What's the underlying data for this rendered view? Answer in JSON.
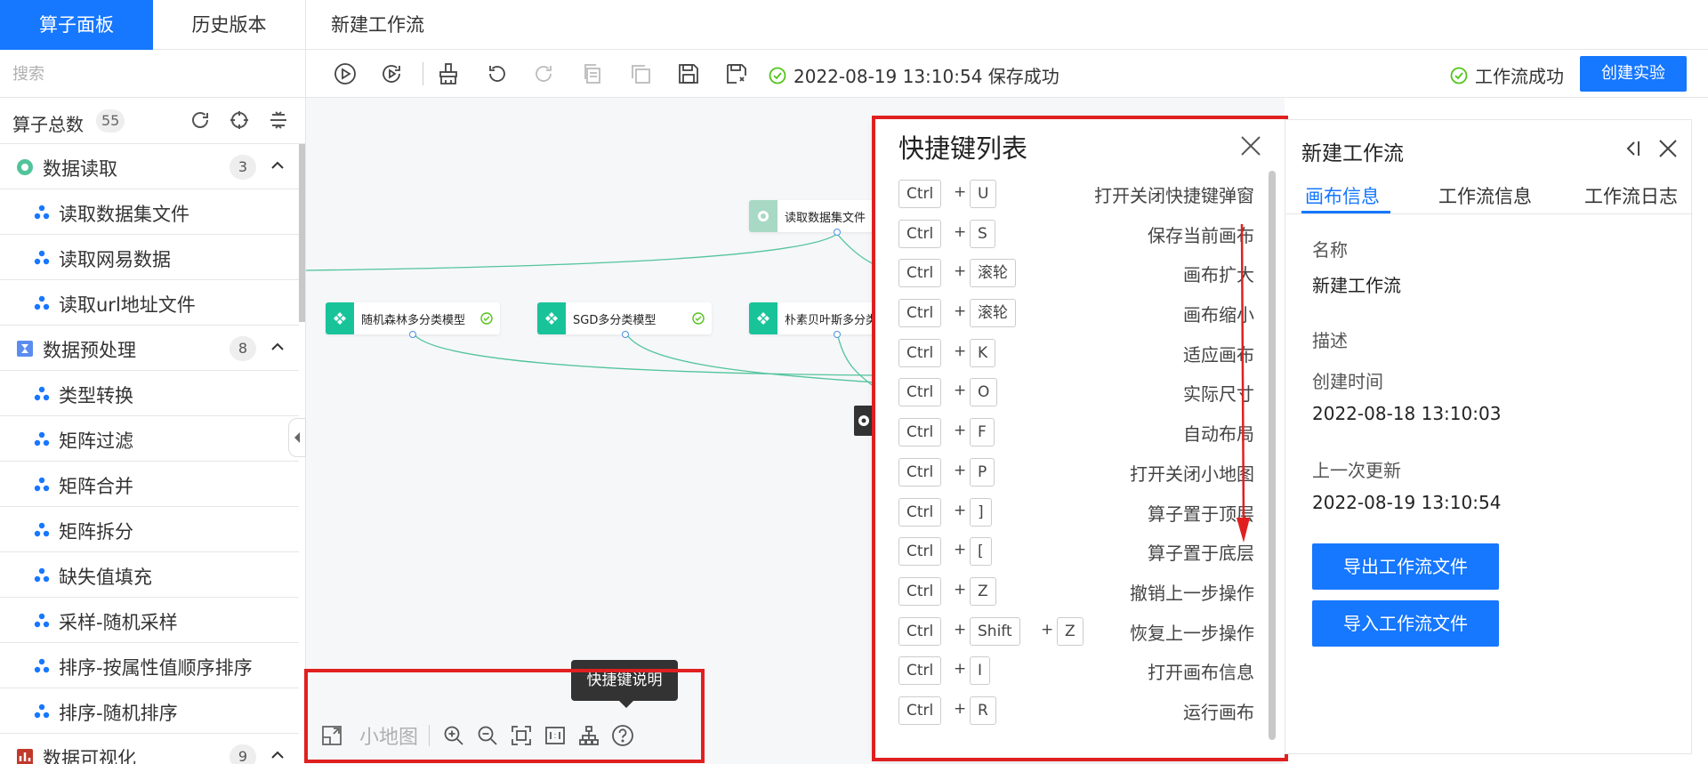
{
  "header": {
    "tab_operators": "算子面板",
    "tab_history": "历史版本",
    "workflow_title": "新建工作流"
  },
  "sidebar": {
    "search_placeholder": "搜索",
    "count_label": "算子总数",
    "count_value": "55",
    "categories": [
      {
        "label": "数据读取",
        "count": "3",
        "icon": "data-read-icon",
        "color": "#52c49a",
        "items": [
          "读取数据集文件",
          "读取网易数据",
          "读取url地址文件"
        ]
      },
      {
        "label": "数据预处理",
        "count": "8",
        "icon": "hourglass-icon",
        "color": "#5b8def",
        "items": [
          "类型转换",
          "矩阵过滤",
          "矩阵合并",
          "矩阵拆分",
          "缺失值填充",
          "采样-随机采样",
          "排序-按属性值顺序排序",
          "排序-随机排序"
        ]
      },
      {
        "label": "数据可视化",
        "count": "9",
        "icon": "chart-icon",
        "color": "#c0392b",
        "items": []
      }
    ]
  },
  "toolbar": {
    "save_status": "2022-08-19 13:10:54 保存成功",
    "workflow_status": "工作流成功",
    "create_button": "创建实验"
  },
  "canvas": {
    "nodes": [
      {
        "label": "读取数据集文件"
      },
      {
        "label": "随机森林多分类模型"
      },
      {
        "label": "SGD多分类模型"
      },
      {
        "label": "朴素贝叶斯多分类"
      }
    ]
  },
  "mini_toolbar": {
    "minimap_label": "小地图",
    "tooltip": "快捷键说明"
  },
  "shortcut_modal": {
    "title": "快捷键列表",
    "shortcuts": [
      {
        "keys": [
          "Ctrl",
          "U"
        ],
        "desc": "打开关闭快捷键弹窗"
      },
      {
        "keys": [
          "Ctrl",
          "S"
        ],
        "desc": "保存当前画布"
      },
      {
        "keys": [
          "Ctrl",
          "滚轮"
        ],
        "desc": "画布扩大"
      },
      {
        "keys": [
          "Ctrl",
          "滚轮"
        ],
        "desc": "画布缩小"
      },
      {
        "keys": [
          "Ctrl",
          "K"
        ],
        "desc": "适应画布"
      },
      {
        "keys": [
          "Ctrl",
          "O"
        ],
        "desc": "实际尺寸"
      },
      {
        "keys": [
          "Ctrl",
          "F"
        ],
        "desc": "自动布局"
      },
      {
        "keys": [
          "Ctrl",
          "P"
        ],
        "desc": "打开关闭小地图"
      },
      {
        "keys": [
          "Ctrl",
          "]"
        ],
        "desc": "算子置于顶层"
      },
      {
        "keys": [
          "Ctrl",
          "["
        ],
        "desc": "算子置于底层"
      },
      {
        "keys": [
          "Ctrl",
          "Z"
        ],
        "desc": "撤销上一步操作"
      },
      {
        "keys": [
          "Ctrl",
          "Shift",
          "Z"
        ],
        "desc": "恢复上一步操作"
      },
      {
        "keys": [
          "Ctrl",
          "I"
        ],
        "desc": "打开画布信息"
      },
      {
        "keys": [
          "Ctrl",
          "R"
        ],
        "desc": "运行画布"
      }
    ]
  },
  "right_panel": {
    "title": "新建工作流",
    "tabs": [
      "画布信息",
      "工作流信息",
      "工作流日志"
    ],
    "name_label": "名称",
    "name_value": "新建工作流",
    "desc_label": "描述",
    "created_label": "创建时间",
    "created_value": "2022-08-18 13:10:03",
    "updated_label": "上一次更新",
    "updated_value": "2022-08-19 13:10:54",
    "export_button": "导出工作流文件",
    "import_button": "导入工作流文件"
  },
  "colors": {
    "primary": "#1677ff",
    "success": "#52c41a",
    "node_green": "#19c39a",
    "highlight_red": "#e02020"
  }
}
